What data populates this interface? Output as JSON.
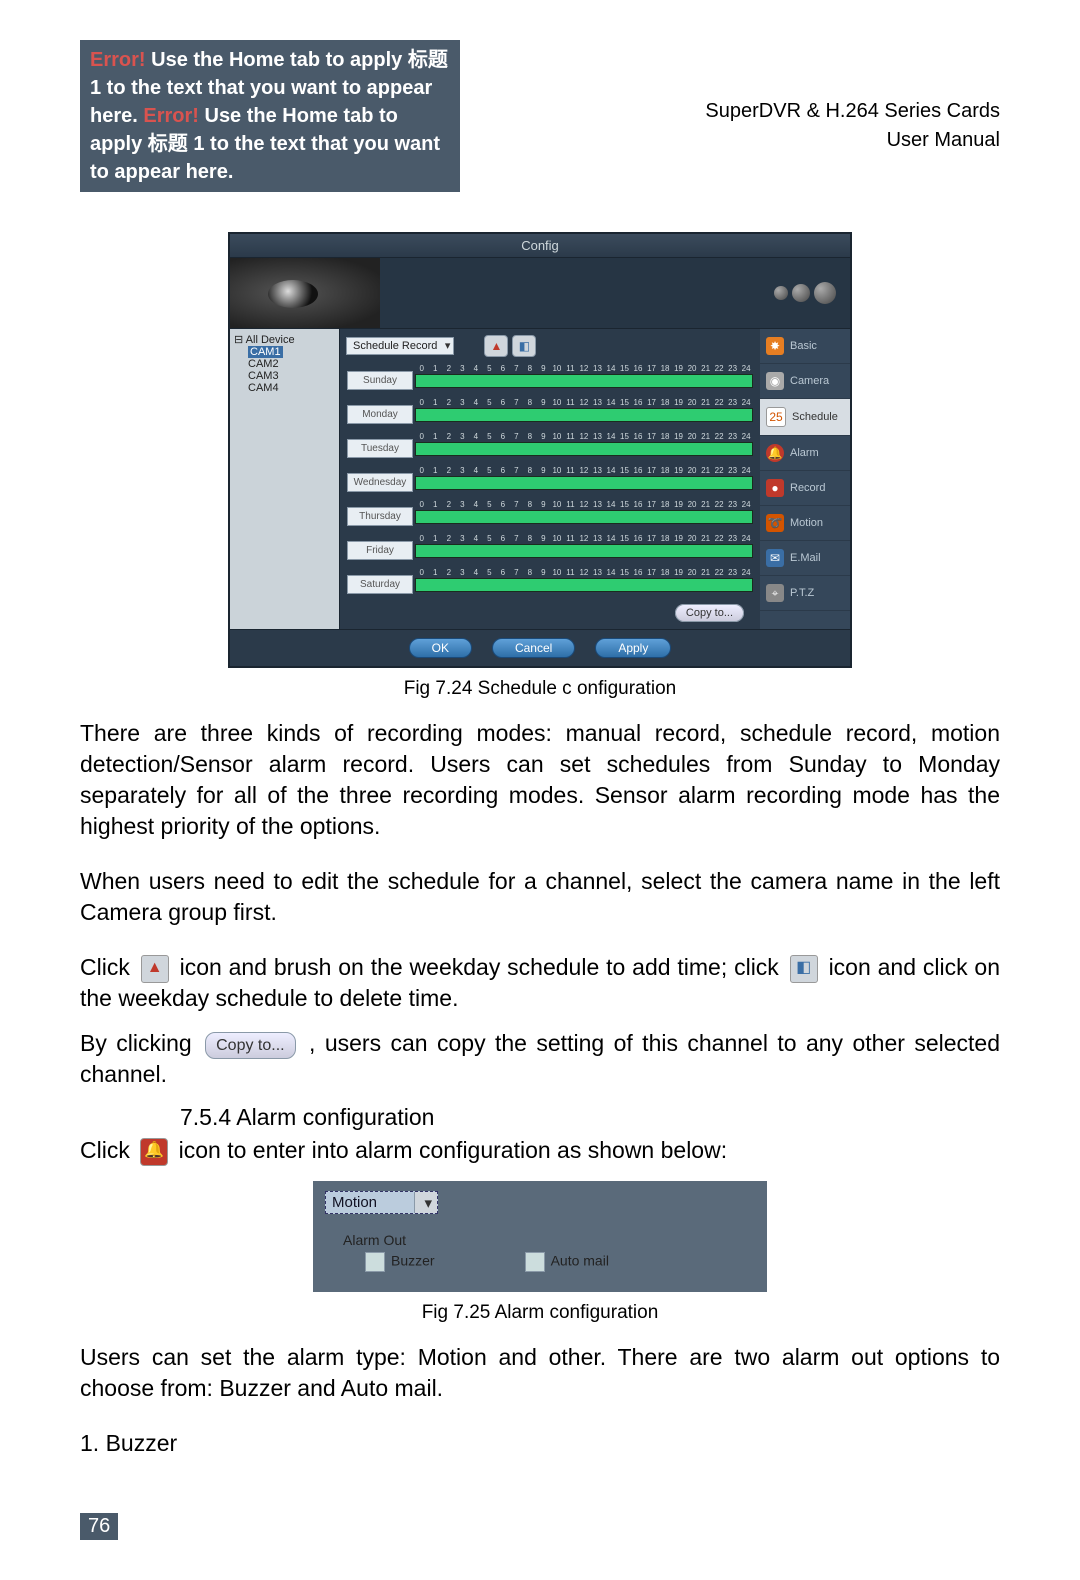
{
  "header": {
    "error_prefix": "Error!",
    "error_text_1": " Use the Home tab to apply 标题 1 to the text that you want to appear here. ",
    "error_prefix2": "Error!",
    "error_text_2": " Use the Home tab to apply 标题 1 to the text that you want to appear here.",
    "product_line1": "SuperDVR & H.264 Series Cards",
    "product_line2": "User  Manual"
  },
  "config": {
    "title": "Config",
    "devices_root": "All Device",
    "devices": [
      "CAM1",
      "CAM2",
      "CAM3",
      "CAM4"
    ],
    "record_select": "Schedule Record",
    "hours": [
      "0",
      "1",
      "2",
      "3",
      "4",
      "5",
      "6",
      "7",
      "8",
      "9",
      "10",
      "11",
      "12",
      "13",
      "14",
      "15",
      "16",
      "17",
      "18",
      "19",
      "20",
      "21",
      "22",
      "23",
      "24"
    ],
    "days": [
      "Sunday",
      "Monday",
      "Tuesday",
      "Wednesday",
      "Thursday",
      "Friday",
      "Saturday"
    ],
    "copy_to": "Copy to...",
    "side": {
      "basic": "Basic",
      "camera": "Camera",
      "schedule": "Schedule",
      "alarm": "Alarm",
      "record": "Record",
      "motion": "Motion",
      "email": "E.Mail",
      "ptz": "P.T.Z"
    },
    "buttons": {
      "ok": "OK",
      "cancel": "Cancel",
      "apply": "Apply"
    }
  },
  "fig724": "Fig 7.24 Schedule c onfiguration",
  "para1": "There are three kinds of recording modes: manual record, schedule record, motion detection/Sensor alarm record. Users can set schedules from Sunday to Monday separately for all of the three recording modes. Sensor alarm recording mode has the highest priority of the options.",
  "para2": "When users need to edit the schedule for a channel, select the camera name in the left Camera group first.",
  "click_line": {
    "pre": "Click ",
    "mid1": " icon and brush on the weekday schedule to add time; click ",
    "mid2": " icon and click on the weekday schedule to delete time."
  },
  "copy_line": {
    "pre": "By clicking ",
    "btn": "Copy to...",
    "post": ", users can copy the setting of this channel to any other selected channel."
  },
  "section_754": "7.5.4  Alarm configuration",
  "alarm_click": {
    "pre": "Click ",
    "post": " icon to enter into alarm configuration as shown below:"
  },
  "alarm_box": {
    "select": "Motion",
    "group": "Alarm Out",
    "cb1": "Buzzer",
    "cb2": "Auto mail"
  },
  "fig725": "Fig 7.25 Alarm configuration",
  "para3": "Users can set the alarm type: Motion and other. There are two alarm out options to choose from: Buzzer and Auto mail.",
  "list1": "1. Buzzer",
  "page_num": "76"
}
